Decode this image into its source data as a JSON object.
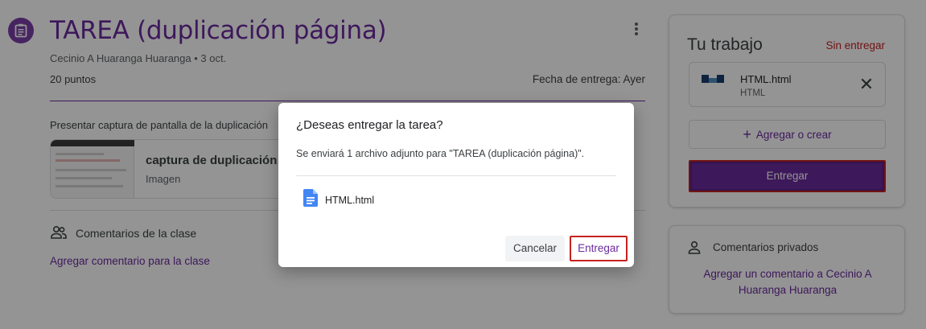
{
  "assignment": {
    "title": "TAREA (duplicación página)",
    "byline": "Cecinio A Huaranga Huaranga • 3 oct.",
    "points": "20 puntos",
    "due": "Fecha de entrega: Ayer",
    "description": "Presentar captura de pantalla de la duplicación",
    "attachment": {
      "title": "captura de duplicación",
      "type": "Imagen"
    },
    "class_comments_label": "Comentarios de la clase",
    "add_class_comment": "Agregar comentario para la clase"
  },
  "your_work": {
    "title": "Tu trabajo",
    "status": "Sin entregar",
    "file": {
      "name": "HTML.html",
      "type": "HTML"
    },
    "add_or_create": "Agregar o crear",
    "submit": "Entregar"
  },
  "private_comments": {
    "title": "Comentarios privados",
    "add": "Agregar un comentario a Cecinio A Huaranga Huaranga"
  },
  "dialog": {
    "title": "¿Deseas entregar la tarea?",
    "body": "Se enviará 1 archivo adjunto para \"TAREA (duplicación página)\".",
    "file_name": "HTML.html",
    "cancel": "Cancelar",
    "submit": "Entregar"
  },
  "colors": {
    "accent": "#6a2a9e",
    "status": "#c5221f",
    "scrim": "#000000"
  }
}
